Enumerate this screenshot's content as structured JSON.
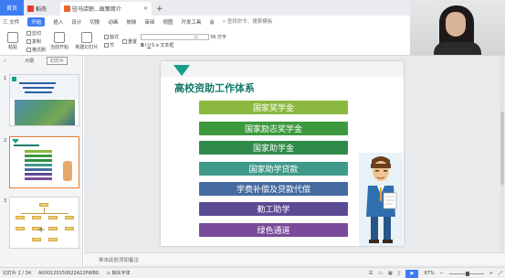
{
  "tabs": {
    "home": "首页",
    "wps": "稻壳",
    "doc": "驻马店职...政策简介",
    "new_tab": "+"
  },
  "menu": {
    "file": "三 文件",
    "items": [
      "开始",
      "插入",
      "设计",
      "切换",
      "动画",
      "放映",
      "审阅",
      "视图",
      "开发工具",
      "会"
    ],
    "active": "开始",
    "search": "查找命令、搜索模板"
  },
  "ribbon": {
    "paste": "粘贴",
    "cut": "剪切",
    "copy": "复制",
    "format_painter": "格式刷",
    "from_current": "当前开始",
    "new_slide": "新建幻灯片",
    "layout": "版式",
    "section": "节",
    "reset": "重置",
    "font_size": "36 万字",
    "text_box": "文本框"
  },
  "left_panel": {
    "tab_outline": "大纲",
    "tab_slides": "幻灯片",
    "slides": [
      {
        "num": "1",
        "title": "驻马店职业技术学院 学生资助政策简介"
      },
      {
        "num": "2",
        "title": "高校资助工作体系"
      },
      {
        "num": "3",
        "title": ""
      }
    ],
    "add": "+"
  },
  "slide": {
    "title": "高校资助工作体系",
    "items": [
      {
        "label": "国家奖学金",
        "color": "#8bb93f"
      },
      {
        "label": "国家励志奖学金",
        "color": "#3d9a3f"
      },
      {
        "label": "国家助学金",
        "color": "#2f8b4a"
      },
      {
        "label": "国家助学贷款",
        "color": "#3f9a8a"
      },
      {
        "label": "学费补偿及贷款代偿",
        "color": "#456aa0"
      },
      {
        "label": "勤工助学",
        "color": "#5b4b94"
      },
      {
        "label": "绿色通道",
        "color": "#7a4b9a"
      }
    ]
  },
  "notes": {
    "placeholder": "单击此处添加备注"
  },
  "status": {
    "slide_pos": "幻灯片 2 / 34",
    "file_id": "A000120150822A22PWBG",
    "missing_font": "缺失字体",
    "zoom": "67%"
  }
}
